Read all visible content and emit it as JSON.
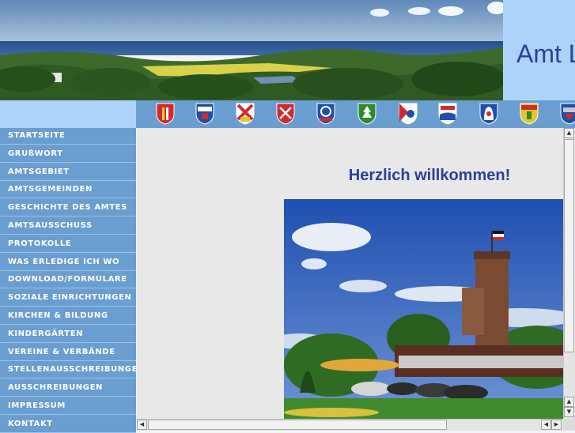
{
  "site": {
    "title": "Amt Lütjenburg"
  },
  "sidebar": {
    "items": [
      "STARTSEITE",
      "GRUßWORT",
      "AMTSGEBIET",
      "AMTSGEMEINDEN",
      "GESCHICHTE DES AMTES",
      "AMTSAUSSCHUSS",
      "PROTOKOLLE",
      "WAS ERLEDIGE ICH WO",
      "DOWNLOAD/FORMULARE",
      "SOZIALE EINRICHTUNGEN",
      "KIRCHEN & BILDUNG",
      "KINDERGÄRTEN",
      "VEREINE & VERBÄNDE",
      "STELLENAUSSCHREIBUNGEN",
      "AUSSCHREIBUNGEN",
      "IMPRESSUM",
      "KONTAKT"
    ]
  },
  "main": {
    "welcome": "Herzlich willkommen!"
  },
  "crests": [
    "crest-1",
    "crest-2",
    "crest-3",
    "crest-4",
    "crest-5",
    "crest-6",
    "crest-7",
    "crest-8",
    "crest-9",
    "crest-10",
    "crest-11"
  ],
  "colors": {
    "nav_bg": "#6a9ed0",
    "title_panel": "#aed3fb",
    "title_text": "#2c3f9e"
  }
}
